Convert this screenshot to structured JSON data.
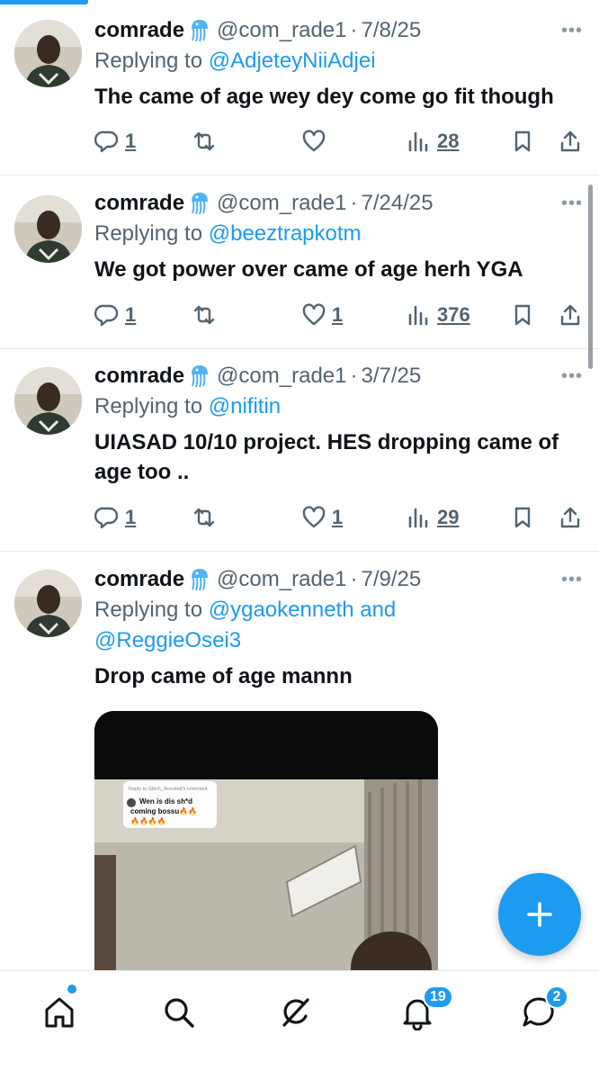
{
  "tweets": [
    {
      "name": "comrade",
      "handle": "@com_rade1",
      "separator": "·",
      "date": "7/8/25",
      "replying_prefix": "Replying to",
      "replying_to": "@AdjeteyNiiAdjei",
      "text": "The came of age wey dey come go fit though",
      "replies": "1",
      "likes": "",
      "views": "28"
    },
    {
      "name": "comrade",
      "handle": "@com_rade1",
      "separator": "·",
      "date": "7/24/25",
      "replying_prefix": "Replying to",
      "replying_to": "@beeztrapkotm",
      "text": "We got power over came of age herh YGA",
      "replies": "1",
      "likes": "1",
      "views": "376"
    },
    {
      "name": "comrade",
      "handle": "@com_rade1",
      "separator": "·",
      "date": "3/7/25",
      "replying_prefix": "Replying to",
      "replying_to": "@nifitin",
      "text": "UIASAD 10/10 project. HES dropping came of age too ..",
      "replies": "1",
      "likes": "1",
      "views": "29"
    },
    {
      "name": "comrade",
      "handle": "@com_rade1",
      "separator": "·",
      "date": "7/9/25",
      "replying_prefix": "Replying to",
      "replying_to": "@ygaokenneth and",
      "replying_to_2": "@ReggieOsei3",
      "text": "Drop came of age mannn",
      "media": {
        "caption_header": "Reply to Glitch_Arrested's comment",
        "caption_line1": "Wen is dis sh*d",
        "caption_line2": "coming bossu🔥🔥",
        "caption_line3": "🔥🔥🔥🔥"
      }
    }
  ],
  "more_glyph": "•••",
  "tabbar": {
    "notifications_badge": "19",
    "messages_badge": "2"
  },
  "colors": {
    "accent": "#1d9bf0",
    "text": "#0f1419",
    "secondary": "#536471",
    "divider": "#e7e9ec"
  },
  "icons": [
    "reply-icon",
    "retweet-icon",
    "like-icon",
    "views-icon",
    "bookmark-icon",
    "share-icon",
    "jellyfish-emoji-icon",
    "compose-plus-icon",
    "home-icon",
    "search-icon",
    "grok-icon",
    "bell-icon",
    "message-icon"
  ]
}
